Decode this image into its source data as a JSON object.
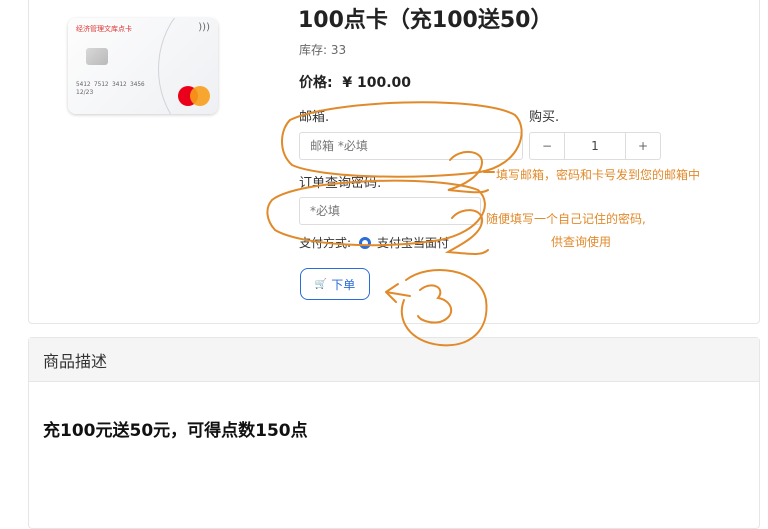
{
  "product": {
    "title": "100点卡（充100送50）",
    "stock_label": "库存:",
    "stock_value": "33",
    "price_label": "价格:",
    "price_value": "¥ 100.00",
    "image": {
      "card_title": "经济管理文库点卡",
      "card_number": "5412 7512 3412 3456",
      "card_date": "12/23"
    }
  },
  "form": {
    "email_label": "邮箱.",
    "email_placeholder": "邮箱 *必填",
    "buy_label": "购买.",
    "quantity": "1",
    "minus": "−",
    "plus": "+",
    "password_label": "订单查询密码:",
    "password_placeholder": "*必填",
    "payment_label": "支付方式:",
    "payment_option": "支付宝当面付",
    "order_button": "下单"
  },
  "description": {
    "header": "商品描述",
    "body": "充100元送50元，可得点数150点"
  },
  "annotations": {
    "note1": "填写邮箱，密码和卡号发到您的邮箱中",
    "note2_line1": "随便填写一个自己记住的密码,",
    "note2_line2": "供查询使用",
    "color": "#e08a2b"
  },
  "colors": {
    "accent": "#2b6cd8",
    "green_tab": "#28a745"
  }
}
